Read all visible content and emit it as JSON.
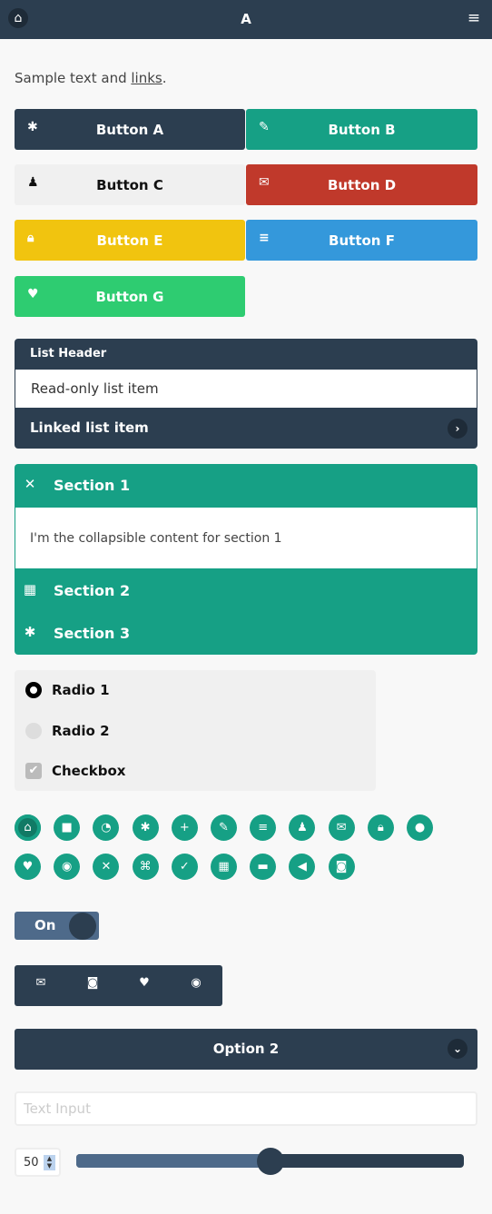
{
  "header": {
    "title": "A",
    "home_icon": "home-icon",
    "menu_icon": "menu-icon"
  },
  "intro": {
    "text": "Sample text and ",
    "link": "links",
    "end": "."
  },
  "buttons": [
    {
      "label": "Button A",
      "icon": "gear-icon",
      "color": "#2c3e50",
      "text": "#fff"
    },
    {
      "label": "Button B",
      "icon": "edit-icon",
      "color": "#16a085",
      "text": "#fff"
    },
    {
      "label": "Button C",
      "icon": "user-icon",
      "color": "#f0f0f0",
      "text": "#111"
    },
    {
      "label": "Button D",
      "icon": "mail-icon",
      "color": "#c0392b",
      "text": "#fff"
    },
    {
      "label": "Button E",
      "icon": "lock-icon",
      "color": "#f1c40f",
      "text": "#fff"
    },
    {
      "label": "Button F",
      "icon": "bars-icon",
      "color": "#3498db",
      "text": "#fff"
    },
    {
      "label": "Button G",
      "icon": "heart-icon",
      "color": "#2ecc71",
      "text": "#fff"
    }
  ],
  "list": {
    "header": "List Header",
    "readonly": "Read-only list item",
    "linked": "Linked list item"
  },
  "accordion": {
    "sections": [
      {
        "title": "Section 1",
        "icon": "close-icon",
        "expanded": true,
        "content": "I'm the collapsible content for section 1"
      },
      {
        "title": "Section 2",
        "icon": "calendar-icon"
      },
      {
        "title": "Section 3",
        "icon": "gear-icon"
      }
    ]
  },
  "form": {
    "radio1": "Radio 1",
    "radio2": "Radio 2",
    "checkbox": "Checkbox",
    "radio1_checked": true,
    "checkbox_checked": true
  },
  "icon_buttons": [
    "home",
    "video",
    "clock",
    "gear",
    "plus",
    "edit",
    "bars",
    "user",
    "mail",
    "lock",
    "location",
    "heart",
    "eye",
    "close",
    "command",
    "check",
    "calendar",
    "comment",
    "audio",
    "camera"
  ],
  "toggle": {
    "label": "On",
    "state": true
  },
  "icon_bar": [
    "mail",
    "camera",
    "heart",
    "eye"
  ],
  "select": {
    "selected": "Option 2"
  },
  "text_input": {
    "placeholder": "Text Input",
    "value": ""
  },
  "slider": {
    "value": "50",
    "min": 0,
    "max": 100
  },
  "colors": {
    "primary": "#2c3e50",
    "accent": "#16a085"
  }
}
